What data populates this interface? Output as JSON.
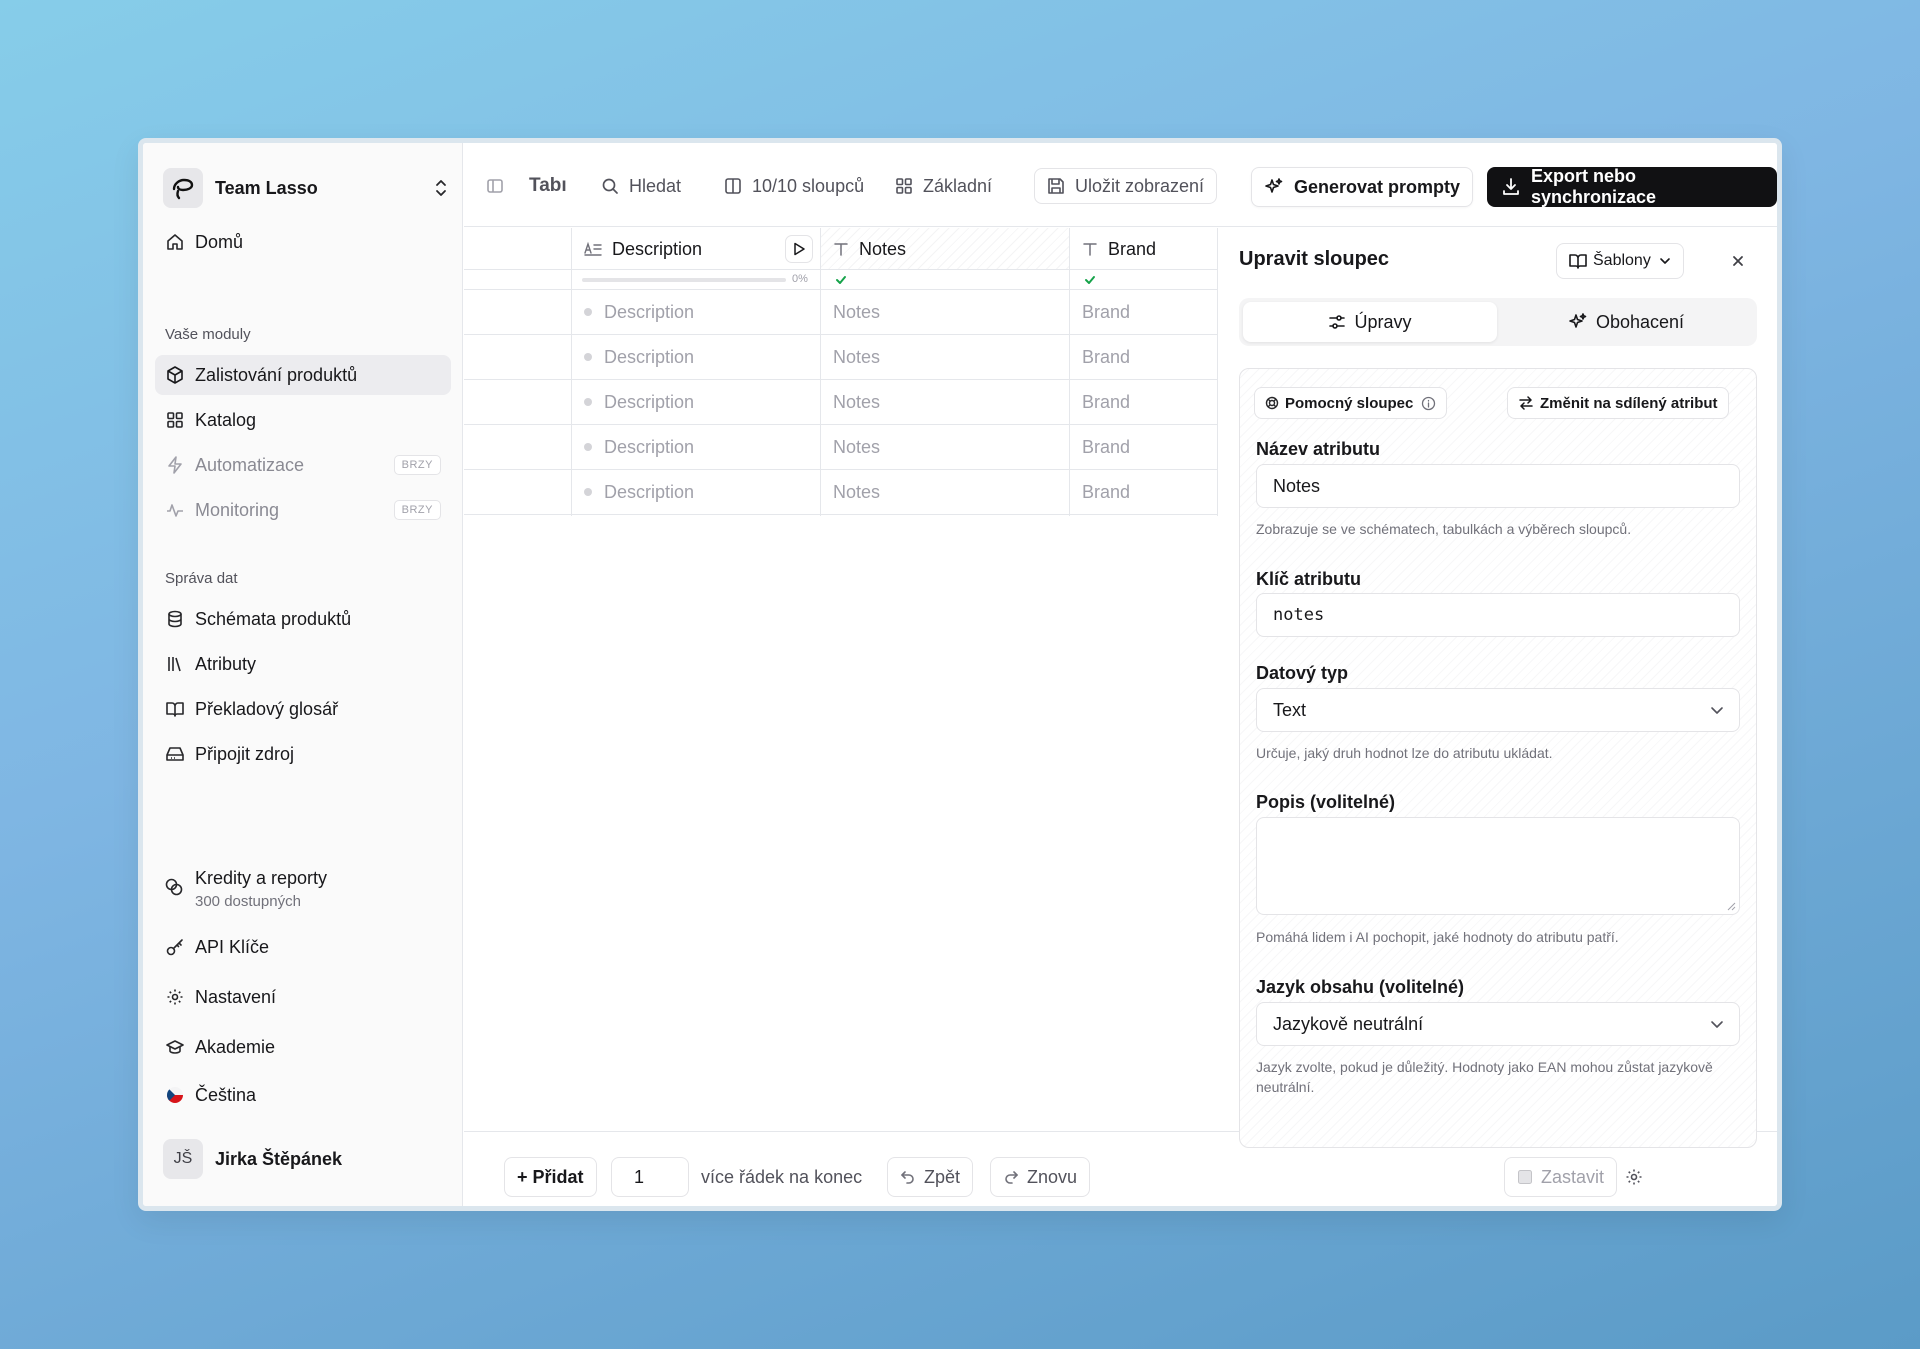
{
  "sidebar": {
    "team_name": "Team Lasso",
    "home": "Domů",
    "modules_label": "Vaše moduly",
    "modules": [
      {
        "label": "Zalistování produktů",
        "icon": "box-icon",
        "active": true
      },
      {
        "label": "Katalog",
        "icon": "grid-icon"
      },
      {
        "label": "Automatizace",
        "icon": "bolt-icon",
        "badge": "BRZY"
      },
      {
        "label": "Monitoring",
        "icon": "activity-icon",
        "badge": "BRZY"
      }
    ],
    "data_label": "Správa dat",
    "data_items": [
      {
        "label": "Schémata produktů",
        "icon": "database-icon"
      },
      {
        "label": "Atributy",
        "icon": "library-icon"
      },
      {
        "label": "Překladový glosář",
        "icon": "book-icon"
      },
      {
        "label": "Připojit zdroj",
        "icon": "drive-icon"
      }
    ],
    "credits_title": "Kredity a reporty",
    "credits_sub": "300 dostupných",
    "api_keys": "API Klíče",
    "settings": "Nastavení",
    "academy": "Akademie",
    "language": "Čeština",
    "user_initials": "JŠ",
    "user_name": "Jirka Štěpánek"
  },
  "toolbar": {
    "table_label": "Tabı",
    "search": "Hledat",
    "columns": "10/10 sloupců",
    "view": "Základní",
    "save_view": "Uložit zobrazení",
    "generate": "Generovat prompty",
    "export": "Export nebo synchronizace"
  },
  "grid": {
    "headers": [
      "Description",
      "Notes",
      "Brand"
    ],
    "progress": "0%",
    "rows": [
      [
        "Description",
        "Notes",
        "Brand"
      ],
      [
        "Description",
        "Notes",
        "Brand"
      ],
      [
        "Description",
        "Notes",
        "Brand"
      ],
      [
        "Description",
        "Notes",
        "Brand"
      ],
      [
        "Description",
        "Notes",
        "Brand"
      ]
    ]
  },
  "footer": {
    "add": "+ Přidat",
    "rows_value": "1",
    "rows_suffix": "více řádek na konec",
    "undo": "Zpět",
    "redo": "Znovu",
    "stop": "Zastavit"
  },
  "panel": {
    "title": "Upravit sloupec",
    "templates": "Šablony",
    "tab_edit": "Úpravy",
    "tab_enrich": "Obohacení",
    "helper_chip": "Pomocný sloupec",
    "shared_chip": "Změnit na sdílený atribut",
    "name_label": "Název atributu",
    "name_value": "Notes",
    "name_help": "Zobrazuje se ve schématech, tabulkách a výběrech sloupců.",
    "key_label": "Klíč atributu",
    "key_value": "notes",
    "type_label": "Datový typ",
    "type_value": "Text",
    "type_help": "Určuje, jaký druh hodnot lze do atributu ukládat.",
    "desc_label": "Popis (volitelné)",
    "desc_help": "Pomáhá lidem i AI pochopit, jaké hodnoty do atributu patří.",
    "lang_label": "Jazyk obsahu (volitelné)",
    "lang_value": "Jazykově neutrální",
    "lang_help": "Jazyk zvolte, pokud je důležitý. Hodnoty jako EAN mohou zůstat jazykově neutrální."
  },
  "colors": {
    "accent_dark": "#111113",
    "success": "#16a34a"
  }
}
